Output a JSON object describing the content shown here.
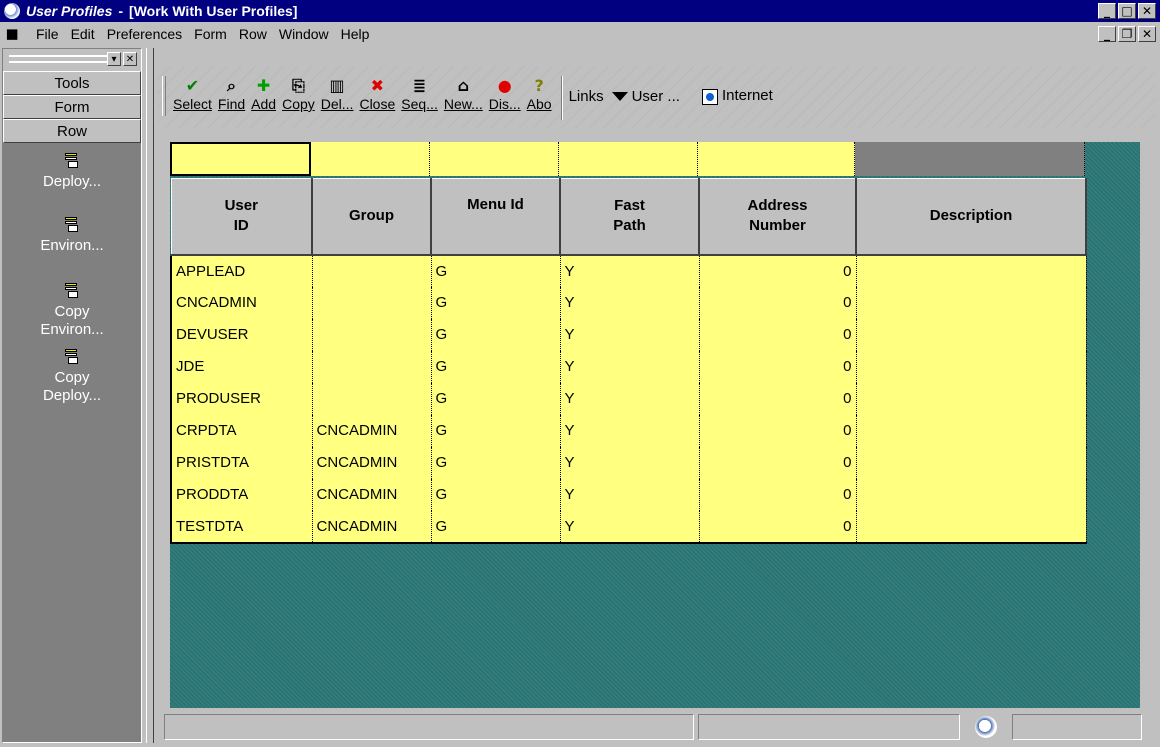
{
  "window": {
    "app_name": "User Profiles",
    "separator": "-",
    "form_title": "[Work With User Profiles]"
  },
  "menubar": {
    "items": [
      "File",
      "Edit",
      "Preferences",
      "Form",
      "Row",
      "Window",
      "Help"
    ]
  },
  "exit_bar": {
    "tabs": [
      "Tools",
      "Form",
      "Row"
    ],
    "items": [
      {
        "label": "Deploy..."
      },
      {
        "label": "Environ..."
      },
      {
        "label": "Copy\nEnviron..."
      },
      {
        "label": "Copy\nDeploy..."
      }
    ]
  },
  "toolbar": {
    "buttons": [
      {
        "label": "Select",
        "icon": "checkmark-icon",
        "glyph": "✔",
        "color": "#008000"
      },
      {
        "label": "Find",
        "icon": "find-icon",
        "glyph": "⌕",
        "color": "#000000"
      },
      {
        "label": "Add",
        "icon": "plus-icon",
        "glyph": "✚",
        "color": "#00a000"
      },
      {
        "label": "Copy",
        "icon": "copy-icon",
        "glyph": "⎘",
        "color": "#000000"
      },
      {
        "label": "Del...",
        "icon": "trash-icon",
        "glyph": "🗑",
        "color": "#000000"
      },
      {
        "label": "Close",
        "icon": "close-x-icon",
        "glyph": "✖",
        "color": "#e00000"
      },
      {
        "label": "Seq...",
        "icon": "sequence-icon",
        "glyph": "≣",
        "color": "#000000"
      },
      {
        "label": "New...",
        "icon": "new-icon",
        "glyph": "⌂",
        "color": "#000000"
      },
      {
        "label": "Dis...",
        "icon": "display-icon",
        "glyph": "●",
        "color": "#e00000"
      },
      {
        "label": "Abo",
        "icon": "about-icon",
        "glyph": "?",
        "color": "#808000"
      }
    ],
    "links_label": "Links",
    "user_label": "User ...",
    "internet_label": "Internet"
  },
  "grid": {
    "columns": [
      "User\nID",
      "Group",
      "Menu Id",
      "Fast\nPath",
      "Address\nNumber",
      "Description"
    ],
    "rows": [
      [
        "APPLEAD",
        "",
        "G",
        "Y",
        "0",
        ""
      ],
      [
        "CNCADMIN",
        "",
        "G",
        "Y",
        "0",
        ""
      ],
      [
        "DEVUSER",
        "",
        "G",
        "Y",
        "0",
        ""
      ],
      [
        "JDE",
        "",
        "G",
        "Y",
        "0",
        ""
      ],
      [
        "PRODUSER",
        "",
        "G",
        "Y",
        "0",
        ""
      ],
      [
        "CRPDTA",
        "CNCADMIN",
        "G",
        "Y",
        "0",
        ""
      ],
      [
        "PRISTDTA",
        "CNCADMIN",
        "G",
        "Y",
        "0",
        ""
      ],
      [
        "PRODDTA",
        "CNCADMIN",
        "G",
        "Y",
        "0",
        ""
      ],
      [
        "TESTDTA",
        "CNCADMIN",
        "G",
        "Y",
        "0",
        ""
      ]
    ]
  },
  "colors": {
    "title_bar": "#000080",
    "grid_cell": "#ffff80",
    "grid_background": "#2f7878",
    "exit_bar": "#808080"
  }
}
